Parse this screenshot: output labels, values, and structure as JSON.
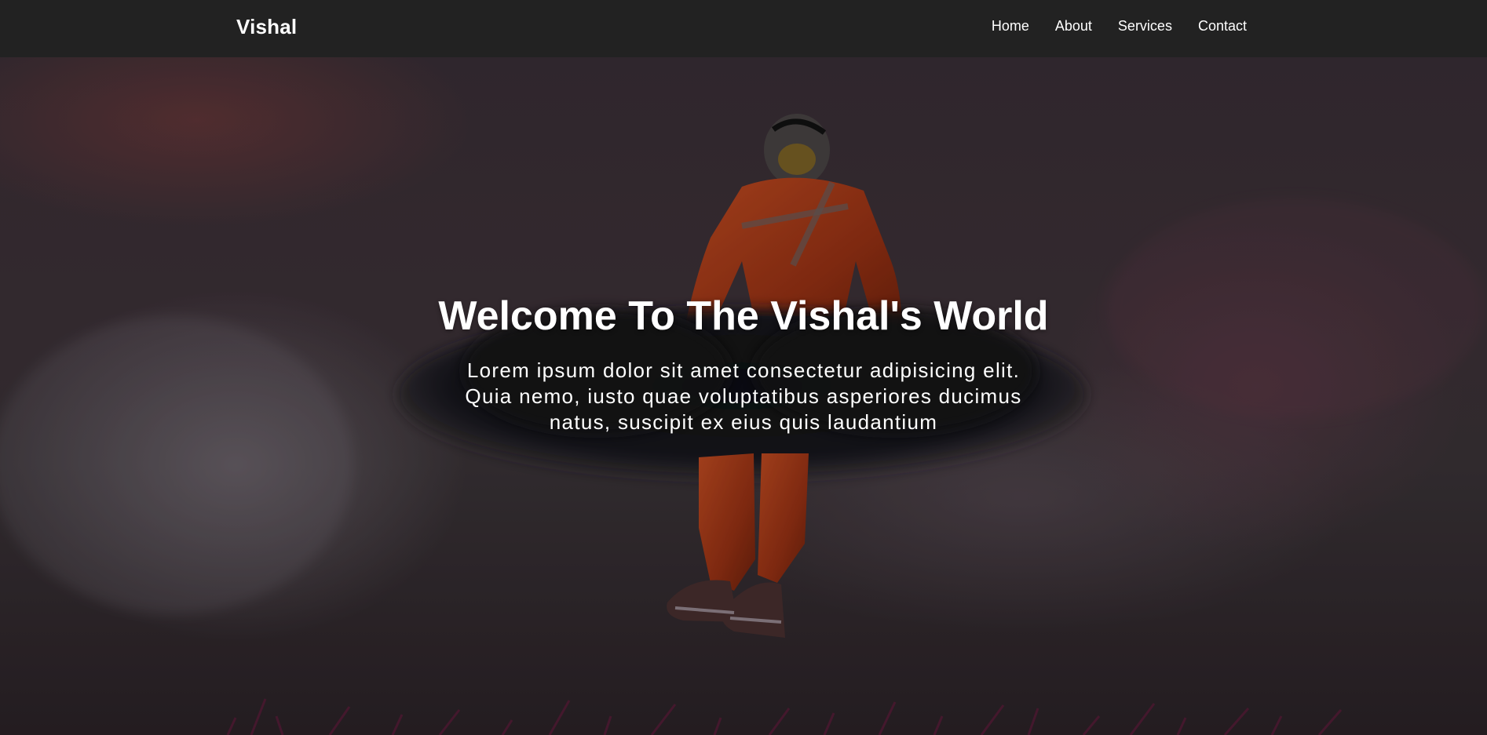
{
  "navbar": {
    "brand": "Vishal",
    "links": [
      {
        "label": "Home"
      },
      {
        "label": "About"
      },
      {
        "label": "Services"
      },
      {
        "label": "Contact"
      }
    ]
  },
  "hero": {
    "title": "Welcome To The Vishal's World",
    "text": "Lorem ipsum dolor sit amet consectetur adipisicing elit. Quia nemo, iusto quae voluptatibus asperiores ducimus natus, suscipit ex eius quis laudantium"
  },
  "colors": {
    "navbar_bg": "#222222",
    "text": "#ffffff",
    "suit": "#b8401c"
  }
}
